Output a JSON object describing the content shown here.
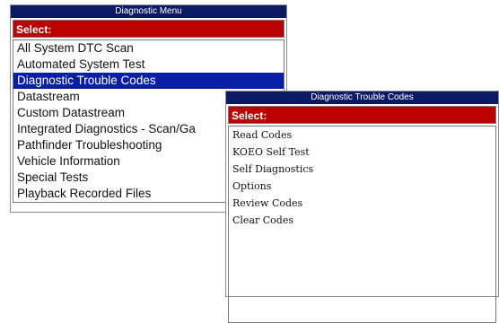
{
  "colors": {
    "title_bg": "#0c1a63",
    "select_bg": "#bb0000",
    "highlight_bg": "#0a1fa8"
  },
  "diagnostic_menu": {
    "title": "Diagnostic Menu",
    "select_label": "Select:",
    "items": [
      {
        "label": "All System DTC Scan",
        "selected": false
      },
      {
        "label": "Automated System Test",
        "selected": false
      },
      {
        "label": "Diagnostic Trouble Codes",
        "selected": true
      },
      {
        "label": "Datastream",
        "selected": false
      },
      {
        "label": "Custom Datastream",
        "selected": false
      },
      {
        "label": "Integrated Diagnostics - Scan/Ga",
        "selected": false
      },
      {
        "label": "Pathfinder Troubleshooting",
        "selected": false
      },
      {
        "label": "Vehicle Information",
        "selected": false
      },
      {
        "label": "Special Tests",
        "selected": false
      },
      {
        "label": "Playback Recorded Files",
        "selected": false
      }
    ]
  },
  "dtc_menu": {
    "title": "Diagnostic Trouble Codes",
    "select_label": "Select:",
    "items": [
      {
        "label": "Read Codes"
      },
      {
        "label": "KOEO Self Test"
      },
      {
        "label": "Self Diagnostics"
      },
      {
        "label": "Options"
      },
      {
        "label": "Review Codes"
      },
      {
        "label": "Clear Codes"
      }
    ]
  }
}
